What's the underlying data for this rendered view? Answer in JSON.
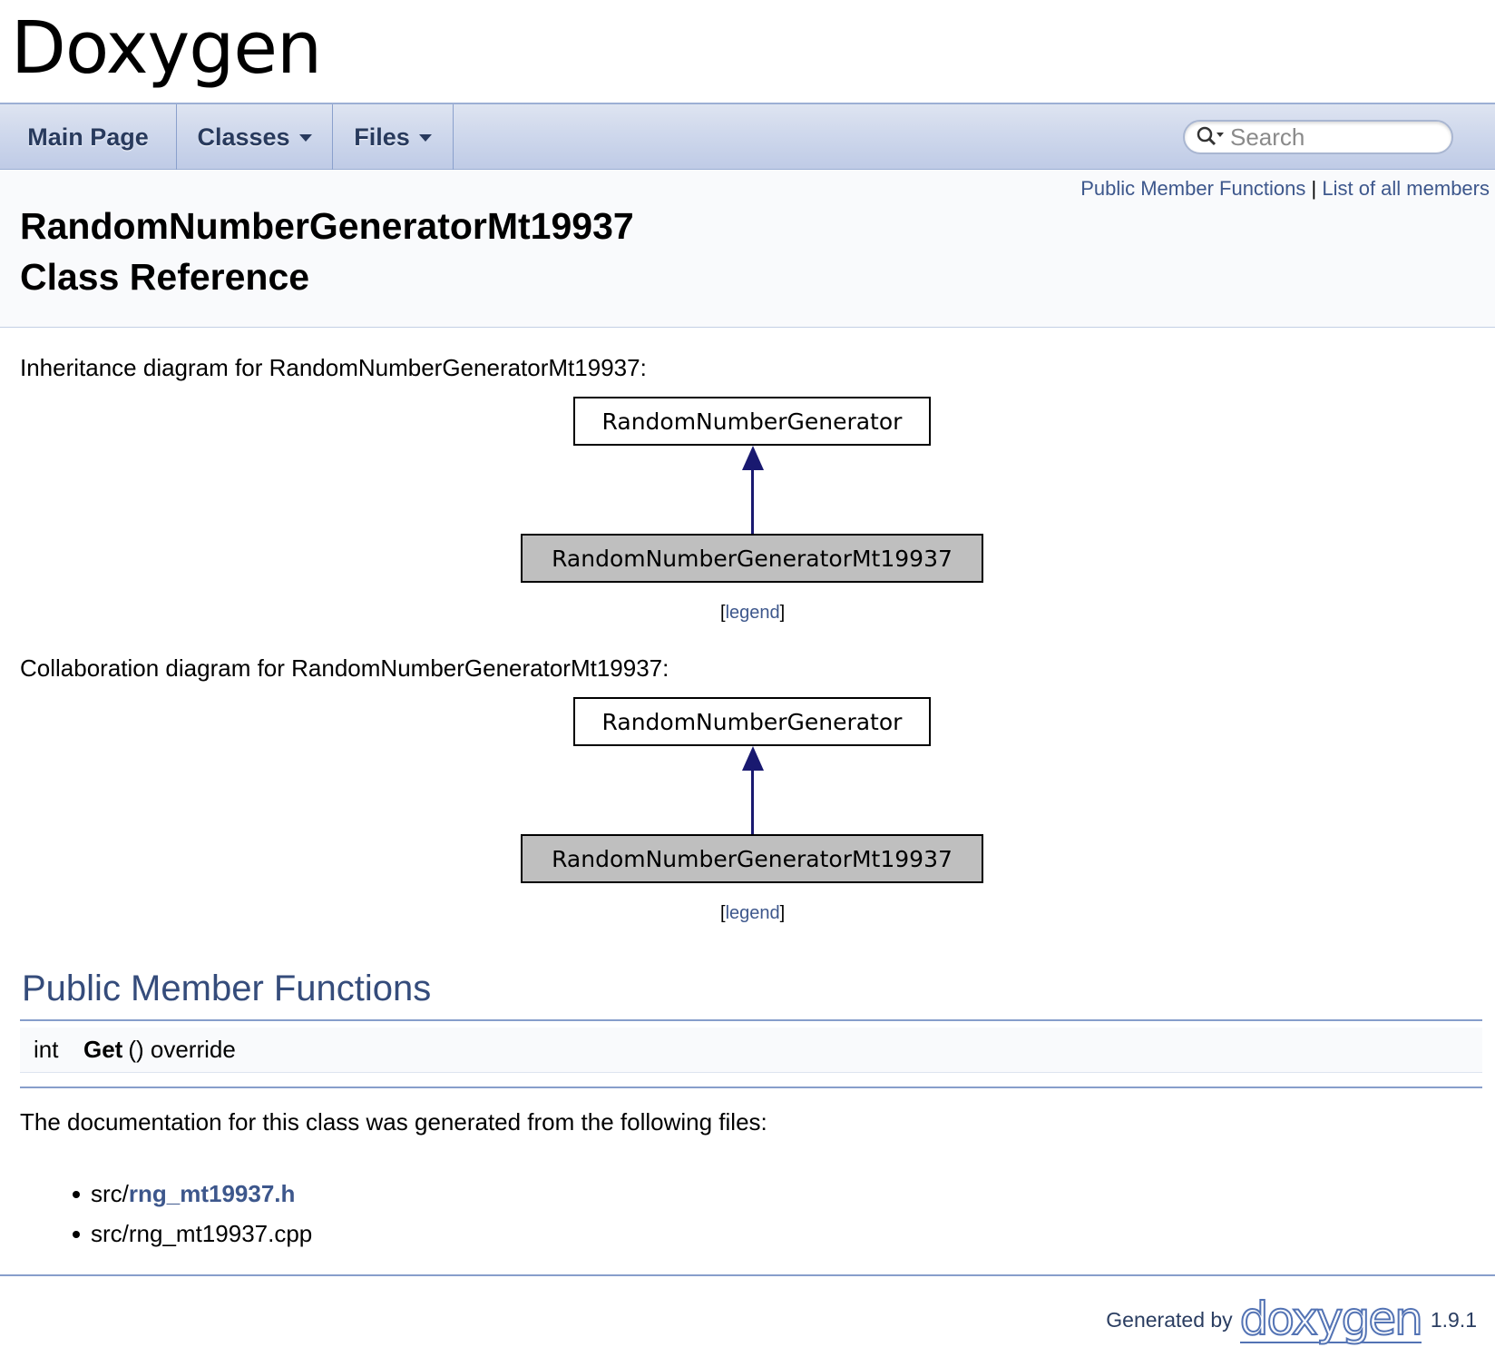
{
  "project": {
    "title": "Doxygen"
  },
  "nav": {
    "items": [
      {
        "label": "Main Page",
        "has_menu": false
      },
      {
        "label": "Classes",
        "has_menu": true
      },
      {
        "label": "Files",
        "has_menu": true
      }
    ],
    "search_placeholder": "Search"
  },
  "header": {
    "summary_links": [
      "Public Member Functions",
      "List of all members"
    ],
    "summary_separator": "|",
    "title_line1": "RandomNumberGeneratorMt19937",
    "title_line2": "Class Reference"
  },
  "inheritance": {
    "caption": "Inheritance diagram for RandomNumberGeneratorMt19937:",
    "base_class": "RandomNumberGenerator",
    "derived_class": "RandomNumberGeneratorMt19937",
    "legend": "legend"
  },
  "collaboration": {
    "caption": "Collaboration diagram for RandomNumberGeneratorMt19937:",
    "base_class": "RandomNumberGenerator",
    "derived_class": "RandomNumberGeneratorMt19937",
    "legend": "legend"
  },
  "members": {
    "heading": "Public Member Functions",
    "rows": [
      {
        "type": "int",
        "name": "Get",
        "signature": "() override"
      }
    ]
  },
  "files": {
    "intro": "The documentation for this class was generated from the following files:",
    "items": [
      {
        "dir": "src/",
        "name": "rng_mt19937.h",
        "linked": true
      },
      {
        "dir": "src/",
        "name": "rng_mt19937.cpp",
        "linked": false
      }
    ]
  },
  "footer": {
    "generated_by": "Generated by",
    "logo_text": "doxygen",
    "version": "1.9.1"
  },
  "colors": {
    "link": "#3d578c",
    "heading": "#354c7b",
    "arrow": "#191970",
    "derived_box": "#bfbfbf"
  }
}
